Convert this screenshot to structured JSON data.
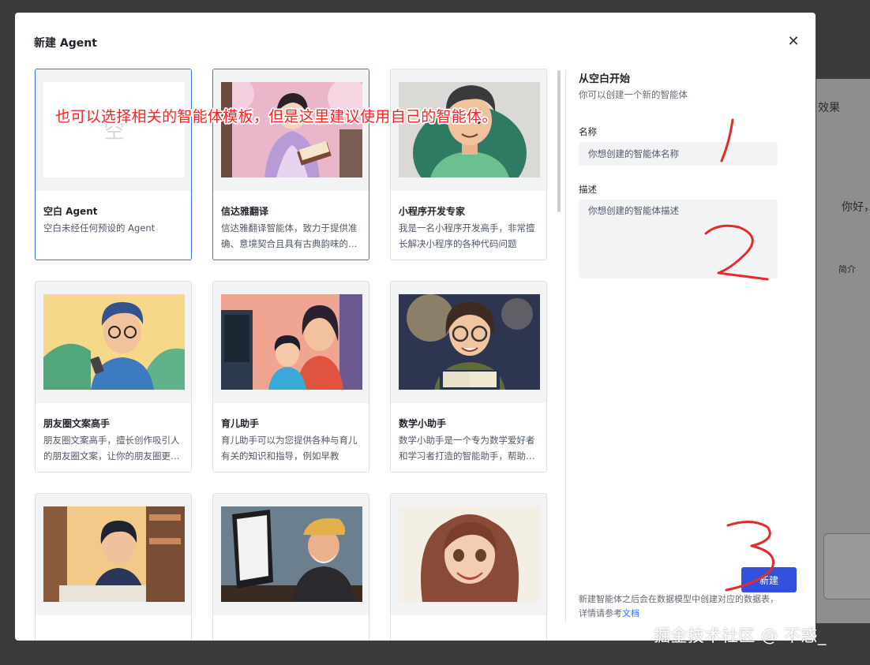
{
  "modal": {
    "title": "新建 Agent",
    "close_icon": "✕"
  },
  "templates": [
    {
      "title": "空白 Agent",
      "desc": "空白未经任何预设的 Agent",
      "blank_glyph": "空",
      "selected": true,
      "image": "blank"
    },
    {
      "title": "信达雅翻译",
      "desc": "信达雅翻译智能体，致力于提供准确、意境契合且具有古典韵味的翻译",
      "selected": true,
      "image": "woman-reading-cherry-blossom"
    },
    {
      "title": "小程序开发专家",
      "desc": "我是一名小程序开发高手，非常擅长解决小程序的各种代码问题",
      "selected": false,
      "image": "young-man-portrait"
    },
    {
      "title": "朋友圈文案高手",
      "desc": "朋友圈文案高手，擅长创作吸引人的朋友圈文案，让你的朋友圈更精彩",
      "selected": false,
      "image": "man-with-phone"
    },
    {
      "title": "育儿助手",
      "desc": "育儿助手可以为您提供各种与育儿有关的知识和指导，例如早教",
      "selected": false,
      "image": "mother-and-child"
    },
    {
      "title": "数学小助手",
      "desc": "数学小助手是一个专为数学爱好者和学习者打造的智能助手，帮助解题",
      "selected": false,
      "image": "girl-with-book"
    },
    {
      "title": "",
      "desc": "",
      "selected": false,
      "image": "boy-studying"
    },
    {
      "title": "",
      "desc": "",
      "selected": false,
      "image": "old-man-computer"
    },
    {
      "title": "",
      "desc": "",
      "selected": false,
      "image": "woman-smiling"
    }
  ],
  "panel": {
    "title": "从空白开始",
    "subtitle": "你可以创建一个新的智能体",
    "name_label": "名称",
    "name_placeholder": "你想创建的智能体名称",
    "desc_label": "描述",
    "desc_placeholder": "你想创建的智能体描述",
    "create_button": "新建",
    "footnote_text": "新建智能体之后会在数据模型中创建对应的数据表，详情请参考",
    "footnote_link": "文档"
  },
  "annotation": {
    "text": "也可以选择相关的智能体模板，但是这里建议使用自己的智能体。",
    "color": "#ff2222",
    "marks": [
      "1",
      "2",
      "3"
    ]
  },
  "background": {
    "partial_texts": [
      "效果",
      "你好，",
      "简介"
    ]
  },
  "watermark": "掘金技术社区 @ 不惑_",
  "colors": {
    "primary": "#3451de",
    "selected_border": "#3370ff",
    "link": "#3370ff"
  }
}
